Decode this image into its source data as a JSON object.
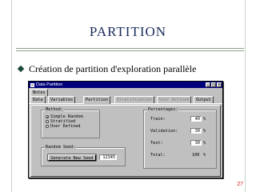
{
  "slide": {
    "title": "PARTITION",
    "bullet": "Création de partition d'exploration parallèle",
    "page_number": "27"
  },
  "window": {
    "title": "Data Partition",
    "tabs": [
      {
        "label": "Notes",
        "state": "normal"
      },
      {
        "label": "Data",
        "state": "normal"
      },
      {
        "label": "Variables",
        "state": "normal"
      },
      {
        "label": "Partition",
        "state": "selected"
      },
      {
        "label": "Stratification",
        "state": "disabled"
      },
      {
        "label": "User Defined",
        "state": "disabled"
      },
      {
        "label": "Output",
        "state": "normal"
      }
    ],
    "method": {
      "label": "Method:",
      "options": [
        "Simple Random",
        "Stratified",
        "User Defined"
      ],
      "selected": "Simple Random"
    },
    "random_seed": {
      "label": "Random Seed:",
      "button": "Generate New Seed",
      "value": "12345"
    },
    "percentages": {
      "label": "Percentages:",
      "train_label": "Train:",
      "train_value": "40",
      "validation_label": "Validation:",
      "validation_value": "30",
      "test_label": "Test:",
      "test_value": "30",
      "total_label": "Total:",
      "total_value": "100",
      "unit": "%"
    }
  }
}
